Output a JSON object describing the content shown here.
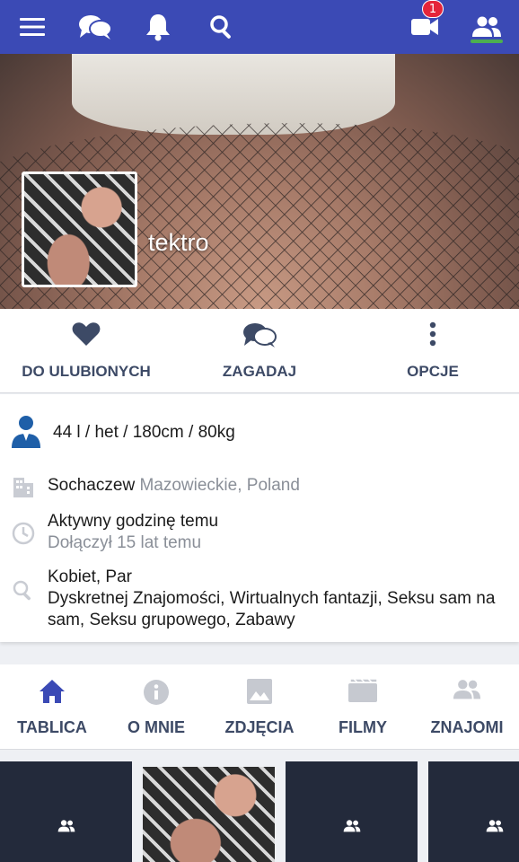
{
  "topbar": {
    "icons": [
      "menu-icon",
      "chat-icon",
      "bell-icon",
      "search-icon",
      "video-icon",
      "friends-icon"
    ],
    "video_badge": "1",
    "colors": {
      "bar": "#3b4ab5",
      "badge": "#e5253a",
      "active_indicator": "#4caf50"
    }
  },
  "profile": {
    "username": "tektro"
  },
  "actions": [
    {
      "label": "DO ULUBIONYCH",
      "icon": "heart-icon"
    },
    {
      "label": "ZAGADAJ",
      "icon": "chat-bubbles-icon"
    },
    {
      "label": "OPCJE",
      "icon": "more-vertical-icon"
    }
  ],
  "info": {
    "stats": "44 l / het / 180cm / 80kg",
    "city": "Sochaczew",
    "region": "Mazowieckie, Poland",
    "active": "Aktywny godzinę temu",
    "joined": "Dołączył 15 lat temu",
    "seeking_who": "Kobiet, Par",
    "seeking_what": "Dyskretnej Znajomości, Wirtualnych fantazji, Seksu sam na sam, Seksu grupowego, Zabawy"
  },
  "tabs": [
    {
      "label": "TABLICA",
      "icon": "home-icon",
      "active": true
    },
    {
      "label": "O MNIE",
      "icon": "info-icon",
      "active": false
    },
    {
      "label": "ZDJĘCIA",
      "icon": "image-icon",
      "active": false
    },
    {
      "label": "FILMY",
      "icon": "film-icon",
      "active": false
    },
    {
      "label": "ZNAJOMI",
      "icon": "people-icon",
      "active": false
    }
  ],
  "friends_strip": [
    "friend-placeholder",
    "friend-photo",
    "friend-placeholder",
    "friend-placeholder"
  ]
}
